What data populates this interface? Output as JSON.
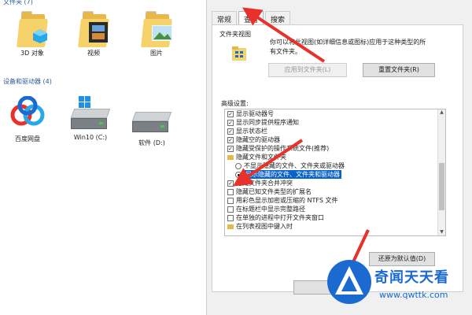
{
  "explorer": {
    "folders_header": "文件夹 (7)",
    "folders": [
      {
        "name": "3D 对象",
        "icon": "3d-objects-folder-icon"
      },
      {
        "name": "视频",
        "icon": "videos-folder-icon"
      },
      {
        "name": "图片",
        "icon": "pictures-folder-icon"
      }
    ],
    "devices_header": "设备和驱动器 (4)",
    "devices": [
      {
        "name": "百度网盘",
        "icon": "baidu-netdisk-icon"
      },
      {
        "name": "Win10 (C:)",
        "icon": "windows-drive-icon"
      },
      {
        "name": "软件 (D:)",
        "icon": "hard-drive-icon"
      }
    ]
  },
  "dialog": {
    "tabs": [
      {
        "label": "常规",
        "active": false
      },
      {
        "label": "查看",
        "active": true
      },
      {
        "label": "搜索",
        "active": false
      }
    ],
    "folder_views": {
      "label": "文件夹视图",
      "description": "你可以将此视图(如详细信息或图标)应用于这种类型的所有文件夹。",
      "apply_button": "应用到文件夹(L)",
      "reset_button": "重置文件夹(R)"
    },
    "advanced": {
      "label": "高级设置:",
      "items": [
        {
          "type": "checkbox",
          "checked": true,
          "text": "显示驱动器号"
        },
        {
          "type": "checkbox",
          "checked": true,
          "text": "显示同步提供程序通知"
        },
        {
          "type": "checkbox",
          "checked": true,
          "text": "显示状态栏"
        },
        {
          "type": "checkbox",
          "checked": true,
          "text": "隐藏空的驱动器"
        },
        {
          "type": "checkbox",
          "checked": true,
          "text": "隐藏受保护的操作系统文件(推荐)"
        },
        {
          "type": "folder",
          "text": "隐藏文件和文件夹"
        },
        {
          "type": "radio",
          "checked": false,
          "text": "不显示隐藏的文件、文件夹或驱动器"
        },
        {
          "type": "radio",
          "checked": true,
          "highlight": true,
          "text": "显示隐藏的文件、文件夹和驱动器"
        },
        {
          "type": "checkbox",
          "checked": true,
          "text": "隐藏文件夹合并冲突"
        },
        {
          "type": "checkbox",
          "checked": false,
          "text": "隐藏已知文件类型的扩展名"
        },
        {
          "type": "checkbox",
          "checked": false,
          "text": "用彩色显示加密或压缩的 NTFS 文件"
        },
        {
          "type": "checkbox",
          "checked": false,
          "text": "在标题栏中显示完整路径"
        },
        {
          "type": "checkbox",
          "checked": false,
          "text": "在单独的进程中打开文件夹窗口"
        },
        {
          "type": "folder",
          "text": "在列表视图中键入时"
        }
      ],
      "restore_button": "还原为默认值(D)"
    }
  },
  "watermark": {
    "name": "奇闻天天看",
    "url": "www.qwttk.com"
  },
  "colors": {
    "accent": "#0a64c8",
    "arrow": "#e8312a",
    "folder": "#f6d26a",
    "watermark": "#1a6ad0"
  }
}
